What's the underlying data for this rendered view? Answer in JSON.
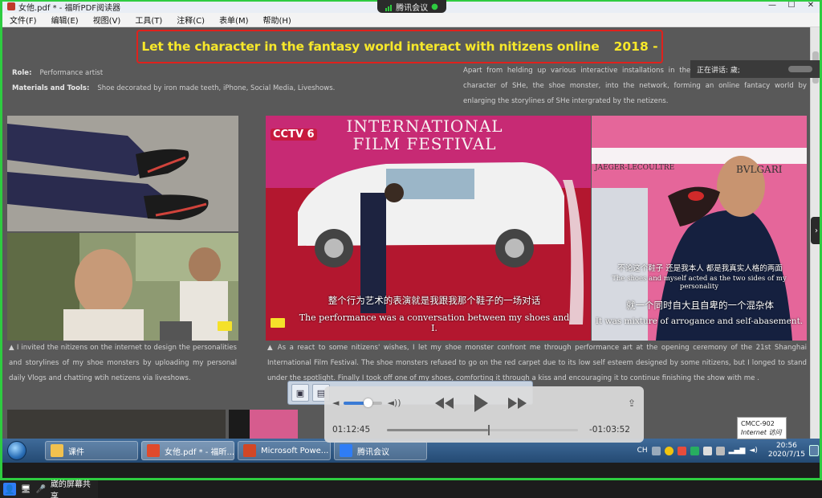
{
  "titlebar": {
    "title": "女他.pdf * - 福昕PDF阅读器",
    "meeting_label": "腾讯会议",
    "minimize": "—",
    "maximize": "☐",
    "close": "✕"
  },
  "menubar": {
    "items": [
      "文件(F)",
      "编辑(E)",
      "视图(V)",
      "工具(T)",
      "注释(C)",
      "表单(M)",
      "帮助(H)"
    ]
  },
  "document": {
    "headline": "Let the character in the fantasy world interact with nitizens online",
    "year": "2018 -",
    "role_label": "Role:",
    "role_value": "Performance artist",
    "materials_label": "Materials and Tools:",
    "materials_value": "Shoe decorated by iron made teeth, iPhone, Social Media, Liveshows.",
    "intro_paragraph": "Apart from helding up various interactive installations in the real world, I also brought the character of SHe, the shoe monster, into the network, forming an online fantacy world by enlarging the storylines of SHe intergrated by the netizens.",
    "left_caption": "▲ I invited the nitizens on the internet to design the personalities and storylines of my shoe monsters by uploading my personal daily Vlogs and chatting wtih netizens via liveshows.",
    "right_caption": "▲ As a react to some nitizens' wishes, I let my shoe monster confront me through performance art at the opening ceremony of the 21st Shanghai International Film Festival. The shoe monsters refused to go on the red carpet due to its low self esteem designed by some nitizens, but I longed to stand under the spotlight. Finally I took off one of my shoes, comforting it through a kiss and encouraging it to continue finishing the show with me .",
    "festival_banner": "INTERNATIONAL FILM FESTIVAL",
    "cctv_logo": "CCTV 6",
    "subtitle_cn_1": "整个行为艺术的表演就是我跟我那个鞋子的一场对话",
    "subtitle_en_1": "The performance was a conversation between my shoes and I.",
    "subtitle_cn_2": "就一个同时自大且自卑的一个混杂体",
    "subtitle_en_2": "It was mixture of arrogance and self-abasement.",
    "subtitle_cn_3": "不论这个鞋子 还是我本人 都是我真实人格的两面",
    "subtitle_en_3": "The shoes and myself acted as the two sides of my personality",
    "sponsor_1": "JAEGER-LECOULTRE",
    "sponsor_2": "BVLGARI"
  },
  "speaker": {
    "label": "正在讲话: 歲;"
  },
  "media": {
    "elapsed": "01:12:45",
    "remaining": "-01:03:52",
    "progress": 0.53,
    "volume": 0.62
  },
  "net_tooltip": {
    "line1": "CMCC-902",
    "line2": "Internet 访问"
  },
  "taskbar": {
    "tasks": [
      "课件",
      "女他.pdf * - 福昕...",
      "Microsoft Powe...",
      "腾讯会议"
    ],
    "lang": "CH",
    "time": "20:56",
    "date": "2020/7/15"
  },
  "sharebar": {
    "label": "崴的屏幕共享"
  },
  "colors": {
    "headline": "#f7e82a",
    "headline_border": "#e0211c",
    "share_frame": "#2ecc40",
    "page_bg": "#595959"
  }
}
